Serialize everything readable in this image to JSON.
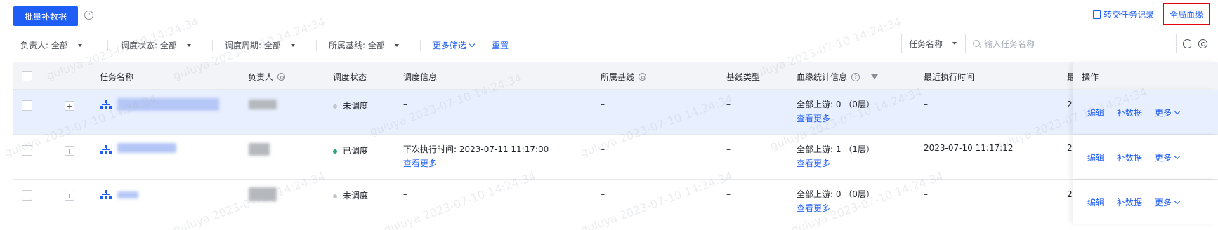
{
  "toolbar": {
    "batch_backfill_label": "批量补数据",
    "transfer_log_label": "转交任务记录",
    "global_lineage_label": "全局血缘"
  },
  "filters": {
    "owner": "负责人: 全部",
    "schedule_status": "调度状态: 全部",
    "schedule_cycle": "调度周期: 全部",
    "baseline": "所属基线: 全部",
    "more": "更多筛选",
    "reset": "重置",
    "search_type": "任务名称",
    "search_placeholder": "输入任务名称"
  },
  "table": {
    "headers": {
      "name": "任务名称",
      "owner": "负责人",
      "status": "调度状态",
      "schedule_info": "调度信息",
      "baseline": "所属基线",
      "baseline_type": "基线类型",
      "lineage": "血缘统计信息",
      "last_run": "最近执行时间",
      "last_run_cut": "最",
      "ops": "操作"
    },
    "rows": [
      {
        "status": "未调度",
        "status_color": "#c2c6cc",
        "schedule_info": "–",
        "schedule_more": "",
        "baseline": "–",
        "baseline_type": "–",
        "lineage": "全部上游: 0 （0层）",
        "lineage_more": "查看更多",
        "last_run": "–",
        "last_run_cut": "2",
        "selected": true
      },
      {
        "status": "已调度",
        "status_color": "#2ba471",
        "schedule_info": "下次执行时间:   2023-07-11 11:17:00",
        "schedule_more": "查看更多",
        "baseline": "–",
        "baseline_type": "–",
        "lineage": "全部上游: 1 （1层）",
        "lineage_more": "查看更多",
        "last_run": "2023-07-10 11:17:12",
        "last_run_cut": "2",
        "selected": false
      },
      {
        "status": "未调度",
        "status_color": "#c2c6cc",
        "schedule_info": "–",
        "schedule_more": "",
        "baseline": "–",
        "baseline_type": "–",
        "lineage": "全部上游: 0 （0层）",
        "lineage_more": "查看更多",
        "last_run": "–",
        "last_run_cut": "2",
        "selected": false
      }
    ],
    "ops": {
      "edit": "编辑",
      "backfill": "补数据",
      "more": "更多"
    }
  },
  "watermark_text": "guluya 2023-07-10 14:24:34",
  "colors": {
    "primary": "#1f5ef5",
    "highlight_box": "#e60012",
    "selected_row": "#e8efff"
  }
}
